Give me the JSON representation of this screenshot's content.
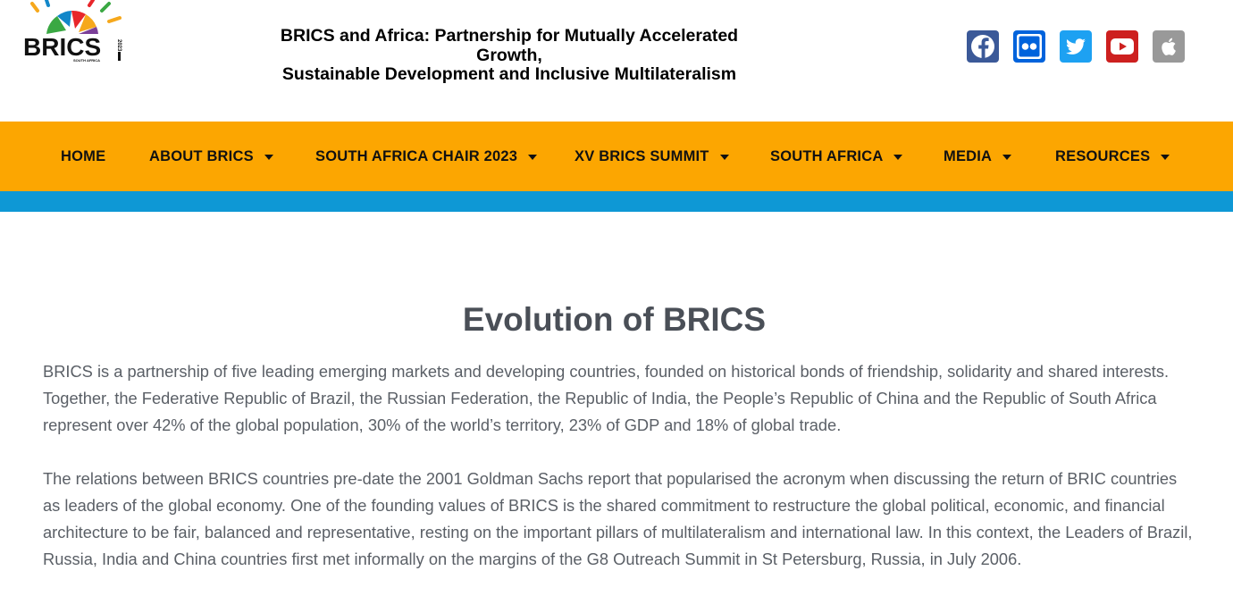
{
  "brand": {
    "logo_text": "BRICS",
    "logo_sub": "SOUTH AFRICA",
    "logo_year": "2023",
    "colors": [
      "#e8262a",
      "#f6a81c",
      "#3aa843",
      "#1287c9",
      "#7b3f98"
    ]
  },
  "header": {
    "tagline_line1": "BRICS and Africa: Partnership for Mutually Accelerated",
    "tagline_line2": "Growth,",
    "tagline_line3": "Sustainable Development and Inclusive Multilateralism"
  },
  "social": [
    {
      "name": "facebook-icon",
      "color": "#3b5998"
    },
    {
      "name": "flickr-icon",
      "color": "#0063dc"
    },
    {
      "name": "twitter-icon",
      "color": "#1da1f2"
    },
    {
      "name": "youtube-icon",
      "color": "#cd201f"
    },
    {
      "name": "apple-icon",
      "color": "#999999"
    }
  ],
  "nav": {
    "items": [
      {
        "label": "HOME",
        "dropdown": false
      },
      {
        "label": "ABOUT BRICS",
        "dropdown": true
      },
      {
        "label": "SOUTH AFRICA CHAIR 2023",
        "dropdown": true
      },
      {
        "label": "XV BRICS SUMMIT",
        "dropdown": true
      },
      {
        "label": "SOUTH AFRICA",
        "dropdown": true
      },
      {
        "label": "MEDIA",
        "dropdown": true
      },
      {
        "label": "RESOURCES",
        "dropdown": true
      }
    ],
    "background": "#fca601",
    "stripe_color": "#0e98d5"
  },
  "main": {
    "title": "Evolution of BRICS",
    "paragraph1": "BRICS is a partnership of five leading emerging markets and developing countries, founded on historical bonds of friendship, solidarity and shared interests. Together, the Federative Republic of Brazil, the Russian Federation, the Republic of India, the People’s Republic of China and the Republic of South Africa represent over 42% of the global population, 30% of the world’s territory, 23% of GDP and 18% of global trade.",
    "paragraph2": "The relations between BRICS countries pre-date the 2001 Goldman Sachs report that popularised the acronym when discussing the return of BRIC countries as leaders of the global economy. One of the founding values of BRICS is the shared commitment to restructure the global political, economic, and financial architecture to be fair, balanced and representative, resting on the important pillars of multilateralism and international law. In this context, the Leaders of Brazil, Russia, India and China countries first met informally on the margins of the G8 Outreach Summit in St Petersburg, Russia, in July 2006."
  }
}
